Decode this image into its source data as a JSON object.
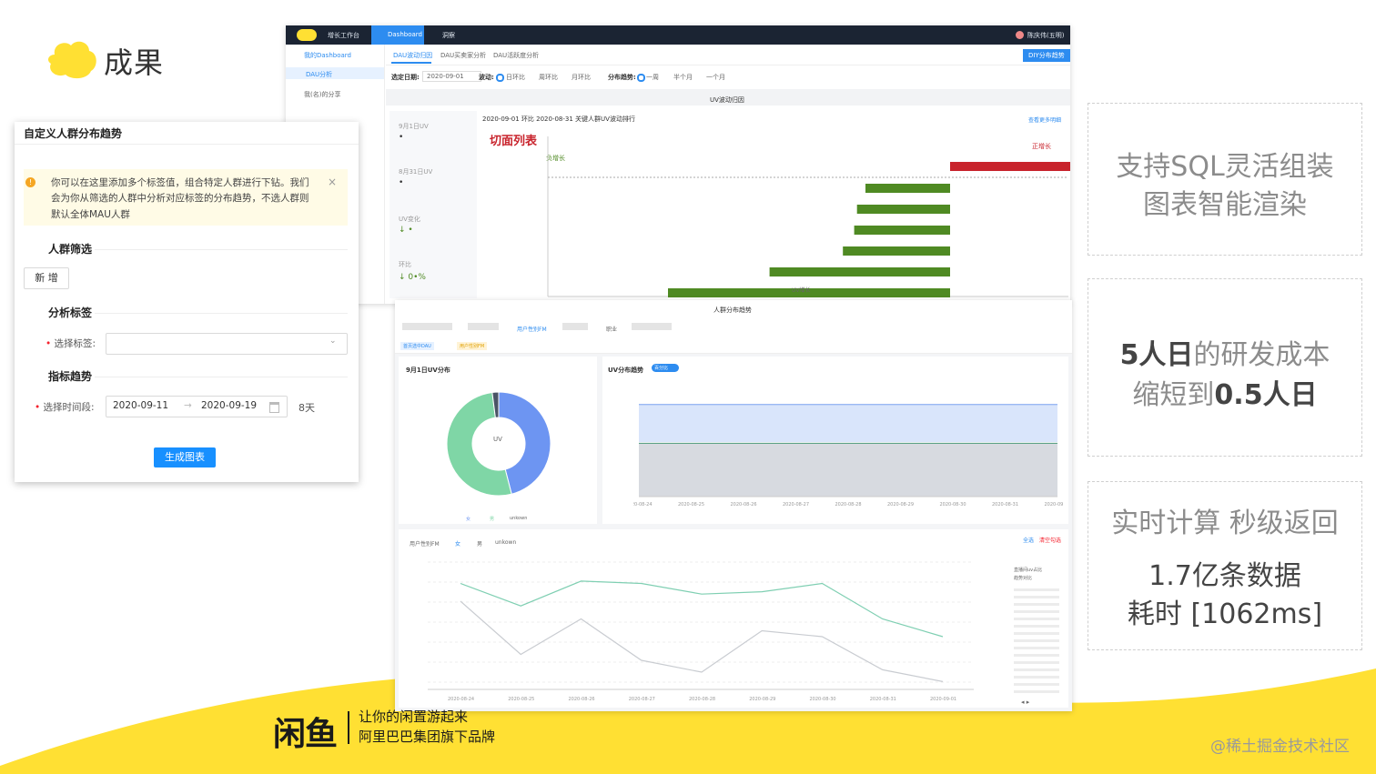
{
  "slide": {
    "title": "成果",
    "accent_color": "#ffe033",
    "brand": {
      "logo_text": "闲鱼",
      "slogan": "让你的闲置游起来",
      "subtitle": "阿里巴巴集团旗下品牌"
    },
    "credit": "@稀土掘金技术社区"
  },
  "dashboard": {
    "nav": {
      "app_name": "增长工作台",
      "tabs": [
        "Dashboard",
        "洞察"
      ],
      "user": "陈庆伟(五明)"
    },
    "sidebar": {
      "items": [
        "我的Dashboard",
        "DAU分析",
        "我(名)的分享"
      ]
    },
    "tabs": [
      "DAU波动归因",
      "DAU买卖家分析",
      "DAU活跃度分析"
    ],
    "action_button": "DIY分布趋势",
    "filters": {
      "date_label": "选定日期:",
      "date_value": "2020-09-01",
      "wave_label": "波动:",
      "wave_options": [
        "日环比",
        "周环比",
        "月环比"
      ],
      "trend_label": "分布趋势:",
      "trend_options": [
        "一周",
        "半个月",
        "一个月"
      ]
    },
    "section_title": "UV波动归因",
    "stats": [
      {
        "label": "9月1日UV",
        "value": "•"
      },
      {
        "label": "8月31日UV",
        "value": "•"
      },
      {
        "label": "UV变化",
        "value": "↓ •"
      },
      {
        "label": "环比",
        "value": "↓ 0•%"
      }
    ],
    "ranking_title": "2020-09-01 环比 2020-08-31 关键人群UV波动排行",
    "more_link": "查看更多明细",
    "slice_list_label": "切面列表",
    "negative_label": "负增长",
    "positive_label": "正增长",
    "xaxis_label": "UV增长",
    "chart_data": {
      "type": "bar",
      "orientation": "horizontal",
      "positive_values": [
        0.5
      ],
      "negative_values": [
        -0.3,
        -0.33,
        -0.34,
        -0.38,
        -0.64,
        -1.0
      ],
      "colors": {
        "positive": "#c8232c",
        "negative": "#4f8a23"
      }
    }
  },
  "custom_panel": {
    "title": "自定义人群分布趋势",
    "alert_lines": [
      "你可以在这里添加多个标签值，组合特定人群进行下钻。我们",
      "会为你从筛选的人群中分析对应标签的分布趋势，不选人群则",
      "默认全体MAU人群"
    ],
    "close_icon": "×",
    "crowd_section": "人群筛选",
    "add_button": "新 增",
    "tag_section": "分析标签",
    "tag_label": "选择标签:",
    "metric_section": "指标趋势",
    "time_label": "选择时间段:",
    "start_date": "2020-09-11",
    "end_date": "2020-09-19",
    "days": "8天",
    "generate_button": "生成图表"
  },
  "trend_panel": {
    "title": "人群分布趋势",
    "tabs": [
      "用户性别FM",
      "职业"
    ],
    "breadcrumb": [
      "首页选中DAU",
      "用户性别FM"
    ],
    "pie_title": "9月1日UV分布",
    "pie_center": "UV",
    "pie_legend": [
      "女",
      "男",
      "unkown"
    ],
    "area_title": "UV分布趋势",
    "toggle_label": "百分比",
    "line_legend": [
      "用户性别FM",
      "女",
      "男",
      "unkown"
    ],
    "line_actions": [
      "全选",
      "清空勾选"
    ],
    "right_legend": [
      "直播间uv占比",
      "趋势对比"
    ],
    "x_dates": [
      "2020-08-24",
      "2020-08-25",
      "2020-08-26",
      "2020-08-27",
      "2020-08-28",
      "2020-08-29",
      "2020-08-30",
      "2020-08-31",
      "2020-09-01"
    ],
    "chart_data": [
      {
        "type": "pie",
        "categories": [
          "女",
          "男",
          "unkown"
        ],
        "values": [
          46,
          52,
          2
        ],
        "colors": [
          "#6d95f2",
          "#7fd6a6",
          "#4a5466"
        ]
      },
      {
        "type": "area",
        "x": [
          "2020-08-24",
          "2020-08-25",
          "2020-08-26",
          "2020-08-27",
          "2020-08-28",
          "2020-08-29",
          "2020-08-30",
          "2020-08-31",
          "2020-09-01"
        ],
        "series": [
          {
            "name": "女",
            "values": [
              0.46,
              0.46,
              0.46,
              0.46,
              0.46,
              0.46,
              0.46,
              0.46,
              0.46
            ]
          },
          {
            "name": "男",
            "values": [
              0.52,
              0.52,
              0.52,
              0.52,
              0.52,
              0.52,
              0.52,
              0.52,
              0.52
            ]
          }
        ]
      },
      {
        "type": "line",
        "x": [
          "2020-08-24",
          "2020-08-25",
          "2020-08-26",
          "2020-08-27",
          "2020-08-28",
          "2020-08-29",
          "2020-08-30",
          "2020-08-31",
          "2020-09-01"
        ],
        "series": [
          {
            "name": "女",
            "values": [
              0.85,
              0.66,
              0.87,
              0.85,
              0.76,
              0.78,
              0.85,
              0.55,
              0.4
            ]
          },
          {
            "name": "男",
            "values": [
              0.7,
              0.25,
              0.55,
              0.2,
              0.1,
              0.45,
              0.4,
              0.12,
              0.02
            ]
          }
        ]
      }
    ]
  },
  "features": [
    {
      "lines": [
        "支持SQL灵活组装",
        "图表智能渲染"
      ]
    },
    {
      "line1_strong": "5人日",
      "line1_rest": "的研发成本",
      "line2_rest": "缩短到",
      "line2_strong": "0.5人日"
    },
    {
      "lines": [
        "实时计算 秒级返回",
        "1.7亿条数据",
        "耗时 [1062ms]"
      ]
    }
  ]
}
